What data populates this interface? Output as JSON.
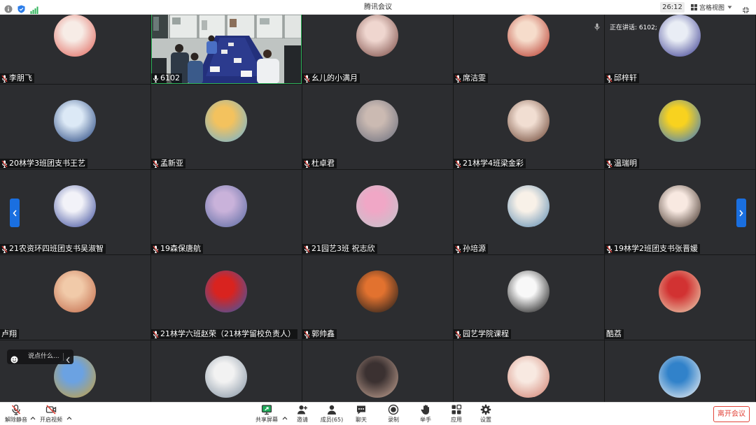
{
  "window": {
    "title": "腾讯会议"
  },
  "titlebar": {
    "icons": [
      "info-icon",
      "shield-icon",
      "signal-icon"
    ],
    "timer": "26:12",
    "view_mode": "宫格视图",
    "view_mode_icons": [
      "grid-view-icon",
      "chevron-down-icon"
    ],
    "fullscreen_icon": "fullscreen-icon"
  },
  "speaking_indicator": {
    "text": "正在讲话: 6102;",
    "icon": "speaker-mic-icon"
  },
  "participants": [
    {
      "name": "李朋飞",
      "mic_icon": "mic-muted-icon",
      "avatar_colors": [
        "#f7ece6",
        "#e0645a"
      ]
    },
    {
      "name": "6102",
      "mic_icon": "mic-icon",
      "video": true,
      "active_speaker": true
    },
    {
      "name": "幺儿的小满月",
      "mic_icon": "mic-muted-icon",
      "avatar_colors": [
        "#efd6cf",
        "#7a4a44"
      ]
    },
    {
      "name": "席洁雯",
      "mic_icon": "mic-muted-icon",
      "avatar_colors": [
        "#f6dccb",
        "#b8392c"
      ]
    },
    {
      "name": "邱梓轩",
      "mic_icon": "mic-muted-icon",
      "avatar_colors": [
        "#e9edf5",
        "#3a3c90"
      ]
    },
    {
      "name": "20林学3班团支书王艺",
      "mic_icon": "mic-muted-icon",
      "avatar_colors": [
        "#dce9f6",
        "#24447e"
      ]
    },
    {
      "name": "孟新亚",
      "mic_icon": "mic-muted-icon",
      "avatar_colors": [
        "#f3c25e",
        "#6fb3d6"
      ]
    },
    {
      "name": "杜卓君",
      "mic_icon": "mic-muted-icon",
      "avatar_colors": [
        "#cbbab2",
        "#6c6f7e"
      ]
    },
    {
      "name": "21林学4班梁金彩",
      "mic_icon": "mic-muted-icon",
      "avatar_colors": [
        "#f1ded2",
        "#6a4231"
      ]
    },
    {
      "name": "温瑞明",
      "mic_icon": "mic-muted-icon",
      "avatar_colors": [
        "#f8d21f",
        "#3a7ac8"
      ]
    },
    {
      "name": "21农资环四班团支书吴淑智",
      "mic_icon": "mic-muted-icon",
      "avatar_colors": [
        "#f2f2f8",
        "#3c4c9c"
      ]
    },
    {
      "name": "19森保唐航",
      "mic_icon": "mic-muted-icon",
      "avatar_colors": [
        "#c9b2da",
        "#5a6aa2"
      ]
    },
    {
      "name": "21园艺3班 祝志欣",
      "mic_icon": "mic-muted-icon",
      "avatar_colors": [
        "#f0a7c6",
        "#c3c3cb"
      ]
    },
    {
      "name": "孙培源",
      "mic_icon": "mic-muted-icon",
      "avatar_colors": [
        "#f8f1e8",
        "#5d8cb2"
      ]
    },
    {
      "name": "19林学2班团支书张晋媛",
      "mic_icon": "mic-muted-icon",
      "avatar_colors": [
        "#f8e9e1",
        "#3b2b22"
      ]
    },
    {
      "name": "卢翔",
      "avatar_colors": [
        "#f1caa9",
        "#c26a4a"
      ]
    },
    {
      "name": "21林学六班赵荣（21林学留校负责人）",
      "mic_icon": "mic-muted-icon",
      "avatar_colors": [
        "#d9231f",
        "#3b59a9"
      ]
    },
    {
      "name": "郭帅鑫",
      "mic_icon": "mic-muted-icon",
      "avatar_colors": [
        "#e2722f",
        "#1b1b1b"
      ]
    },
    {
      "name": "园艺学院课程",
      "mic_icon": "mic-muted-icon",
      "avatar_colors": [
        "#f8f8f8",
        "#111111"
      ]
    },
    {
      "name": "酷荔",
      "avatar_colors": [
        "#d23232",
        "#e9d1b1"
      ]
    },
    {
      "avatar_colors": [
        "#6ba2e2",
        "#c8a23f"
      ]
    },
    {
      "avatar_colors": [
        "#f2f2f2",
        "#8392a2"
      ]
    },
    {
      "avatar_colors": [
        "#3b3131",
        "#c2a292"
      ]
    },
    {
      "avatar_colors": [
        "#f8e9e1",
        "#d18171"
      ]
    },
    {
      "avatar_colors": [
        "#3182ca",
        "#f2f2f2"
      ]
    }
  ],
  "pager": {
    "prev_icon": "chevron-left-icon",
    "next_icon": "chevron-right-icon"
  },
  "chat_input": {
    "placeholder": "说点什么...",
    "emoji_icon": "emoji-icon",
    "collapse_icon": "chevron-left-icon"
  },
  "toolbar": {
    "items": [
      {
        "label": "解除静音",
        "icon": "mic-muted-icon"
      },
      {
        "label": "开启视频",
        "icon": "camera-off-icon"
      },
      {
        "label": "共享屏幕",
        "icon": "share-screen-icon"
      },
      {
        "label": "邀请",
        "icon": "invite-icon"
      },
      {
        "label": "成员(65)",
        "icon": "members-icon"
      },
      {
        "label": "聊天",
        "icon": "chat-icon"
      },
      {
        "label": "录制",
        "icon": "record-icon"
      },
      {
        "label": "举手",
        "icon": "raise-hand-icon"
      },
      {
        "label": "应用",
        "icon": "apps-icon"
      },
      {
        "label": "设置",
        "icon": "settings-icon"
      }
    ],
    "leave_label": "离开会议"
  },
  "colors": {
    "accent": "#1a6fe0",
    "active_speaker_border": "#2fb35a",
    "leave": "#e2443a",
    "tile_bg": "#2c2d30",
    "muted_slash": "#e2443a"
  }
}
